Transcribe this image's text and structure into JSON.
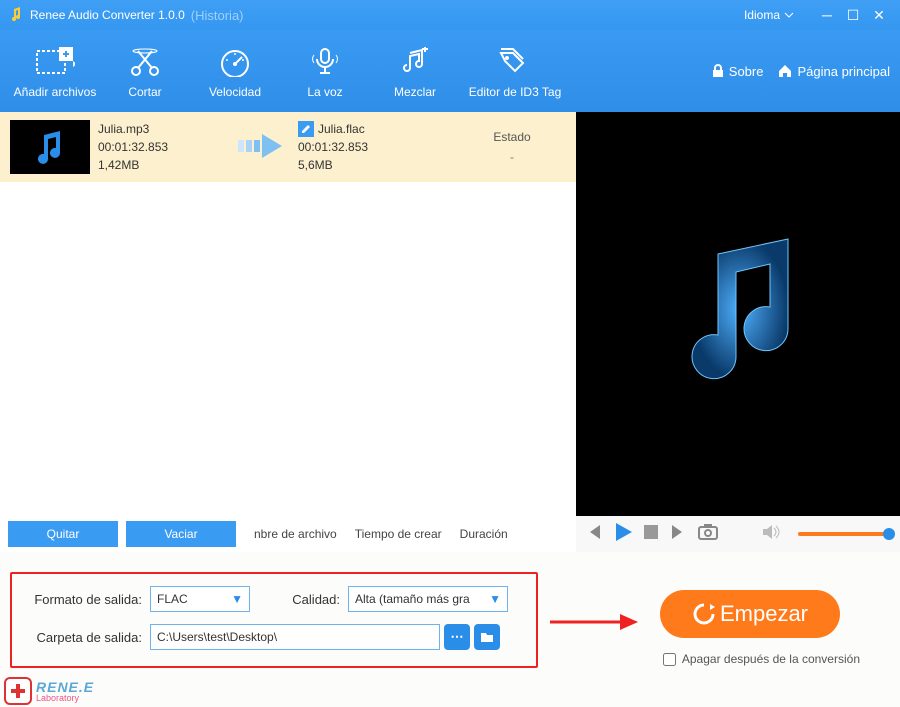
{
  "titlebar": {
    "title": "Renee Audio Converter 1.0.0",
    "subtitle": "(Historia)",
    "language_label": "Idioma"
  },
  "toolbar": {
    "add_files": "Añadir archivos",
    "cut": "Cortar",
    "speed": "Velocidad",
    "voice": "La voz",
    "mix": "Mezclar",
    "id3": "Editor de ID3 Tag",
    "about": "Sobre",
    "home": "Página principal"
  },
  "file": {
    "src_name": "Julia.mp3",
    "src_duration": "00:01:32.853",
    "src_size": "1,42MB",
    "dst_name": "Julia.flac",
    "dst_duration": "00:01:32.853",
    "dst_size": "5,6MB",
    "state_header": "Estado",
    "state_value": "-"
  },
  "listfooter": {
    "remove": "Quitar",
    "clear": "Vaciar",
    "sort_name": "nbre de archivo",
    "sort_time": "Tiempo de crear",
    "sort_duration": "Duración"
  },
  "settings": {
    "format_label": "Formato de salida:",
    "format_value": "FLAC",
    "quality_label": "Calidad:",
    "quality_value": "Alta (tamaño más gra",
    "folder_label": "Carpeta de salida:",
    "folder_value": "C:\\Users\\test\\Desktop\\",
    "start": "Empezar",
    "shutdown": "Apagar después de la conversión"
  },
  "brand": {
    "name": "RENE.E",
    "lab": "Laboratory"
  }
}
